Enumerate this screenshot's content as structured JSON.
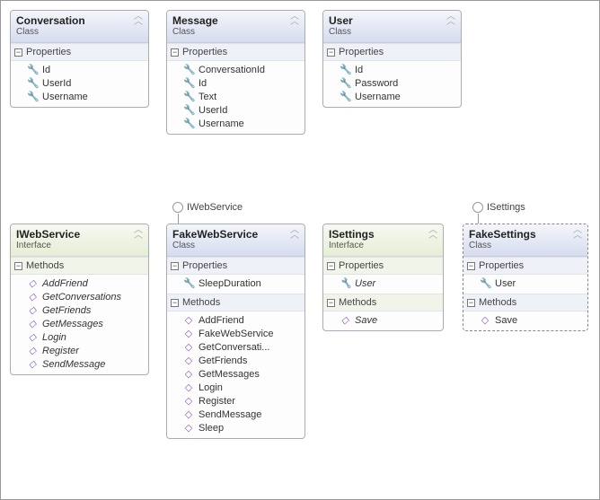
{
  "labels": {
    "classStereo": "Class",
    "interfaceStereo": "Interface",
    "propertiesSection": "Properties",
    "methodsSection": "Methods"
  },
  "lollipops": {
    "webService": "IWebService",
    "settings": "ISettings"
  },
  "shapes": {
    "conversation": {
      "title": "Conversation",
      "stereo": "Class",
      "properties": [
        "Id",
        "UserId",
        "Username"
      ]
    },
    "message": {
      "title": "Message",
      "stereo": "Class",
      "properties": [
        "ConversationId",
        "Id",
        "Text",
        "UserId",
        "Username"
      ]
    },
    "user": {
      "title": "User",
      "stereo": "Class",
      "properties": [
        "Id",
        "Password",
        "Username"
      ]
    },
    "iWebService": {
      "title": "IWebService",
      "stereo": "Interface",
      "methods": [
        "AddFriend",
        "GetConversations",
        "GetFriends",
        "GetMessages",
        "Login",
        "Register",
        "SendMessage"
      ]
    },
    "fakeWebService": {
      "title": "FakeWebService",
      "stereo": "Class",
      "properties": [
        "SleepDuration"
      ],
      "methods": [
        "AddFriend",
        "FakeWebService",
        "GetConversati...",
        "GetFriends",
        "GetMessages",
        "Login",
        "Register",
        "SendMessage",
        "Sleep"
      ]
    },
    "iSettings": {
      "title": "ISettings",
      "stereo": "Interface",
      "properties": [
        "User"
      ],
      "methods": [
        "Save"
      ]
    },
    "fakeSettings": {
      "title": "FakeSettings",
      "stereo": "Class",
      "properties": [
        "User"
      ],
      "methods": [
        "Save"
      ]
    }
  }
}
